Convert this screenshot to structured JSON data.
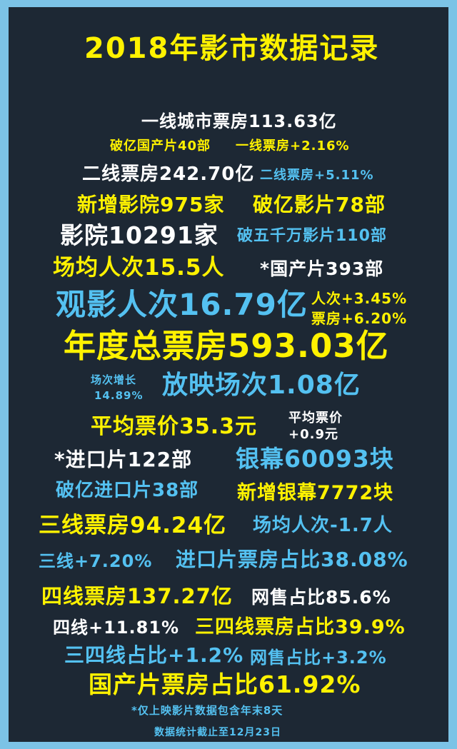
{
  "title": "2018年影市数据记录",
  "colors": {
    "yellow": "#fff200",
    "white": "#ffffff",
    "blue": "#54c1f1",
    "background": "#1d2834",
    "frame": "#7cc3e6"
  },
  "items": {
    "tier1_box_office": "一线城市票房113.63亿",
    "domestic_100m_films": "破亿国产片40部",
    "tier1_growth": "一线票房+2.16%",
    "tier2_box_office": "二线票房242.70亿",
    "tier2_growth": "二线票房+5.11%",
    "new_cinemas": "新增影院975家",
    "films_over_100m": "破亿影片78部",
    "cinemas_total": "影院10291家",
    "films_over_50m": "破五千万影片110部",
    "avg_attendance": "场均人次15.5人",
    "domestic_films": "*国产片393部",
    "admissions": "观影人次16.79亿",
    "admissions_growth": "人次+3.45%",
    "box_office_growth": "票房+6.20%",
    "total_box_office": "年度总票房593.03亿",
    "screenings_growth_label": "场次增长",
    "screenings_growth_value": "14.89%",
    "screenings": "放映场次1.08亿",
    "avg_ticket_price": "平均票价35.3元",
    "ticket_price_change_label": "平均票价",
    "ticket_price_change_value": "+0.9元",
    "imported_films": "*进口片122部",
    "screens_total": "银幕60093块",
    "imported_100m_films": "破亿进口片38部",
    "new_screens": "新增银幕7772块",
    "tier3_box_office": "三线票房94.24亿",
    "attendance_change": "场均人次-1.7人",
    "tier3_growth": "三线+7.20%",
    "imported_share": "进口片票房占比38.08%",
    "tier4_box_office": "四线票房137.27亿",
    "online_share": "网售占比85.6%",
    "tier4_growth": "四线+11.81%",
    "tier34_share": "三四线票房占比39.9%",
    "tier34_share_growth": "三四线占比+1.2%",
    "online_share_growth": "网售占比+3.2%",
    "domestic_share": "国产片票房占比61.92%"
  },
  "footnote": "*仅上映影片数据包含年末8天",
  "cutoff": "数据统计截止至12月23日"
}
